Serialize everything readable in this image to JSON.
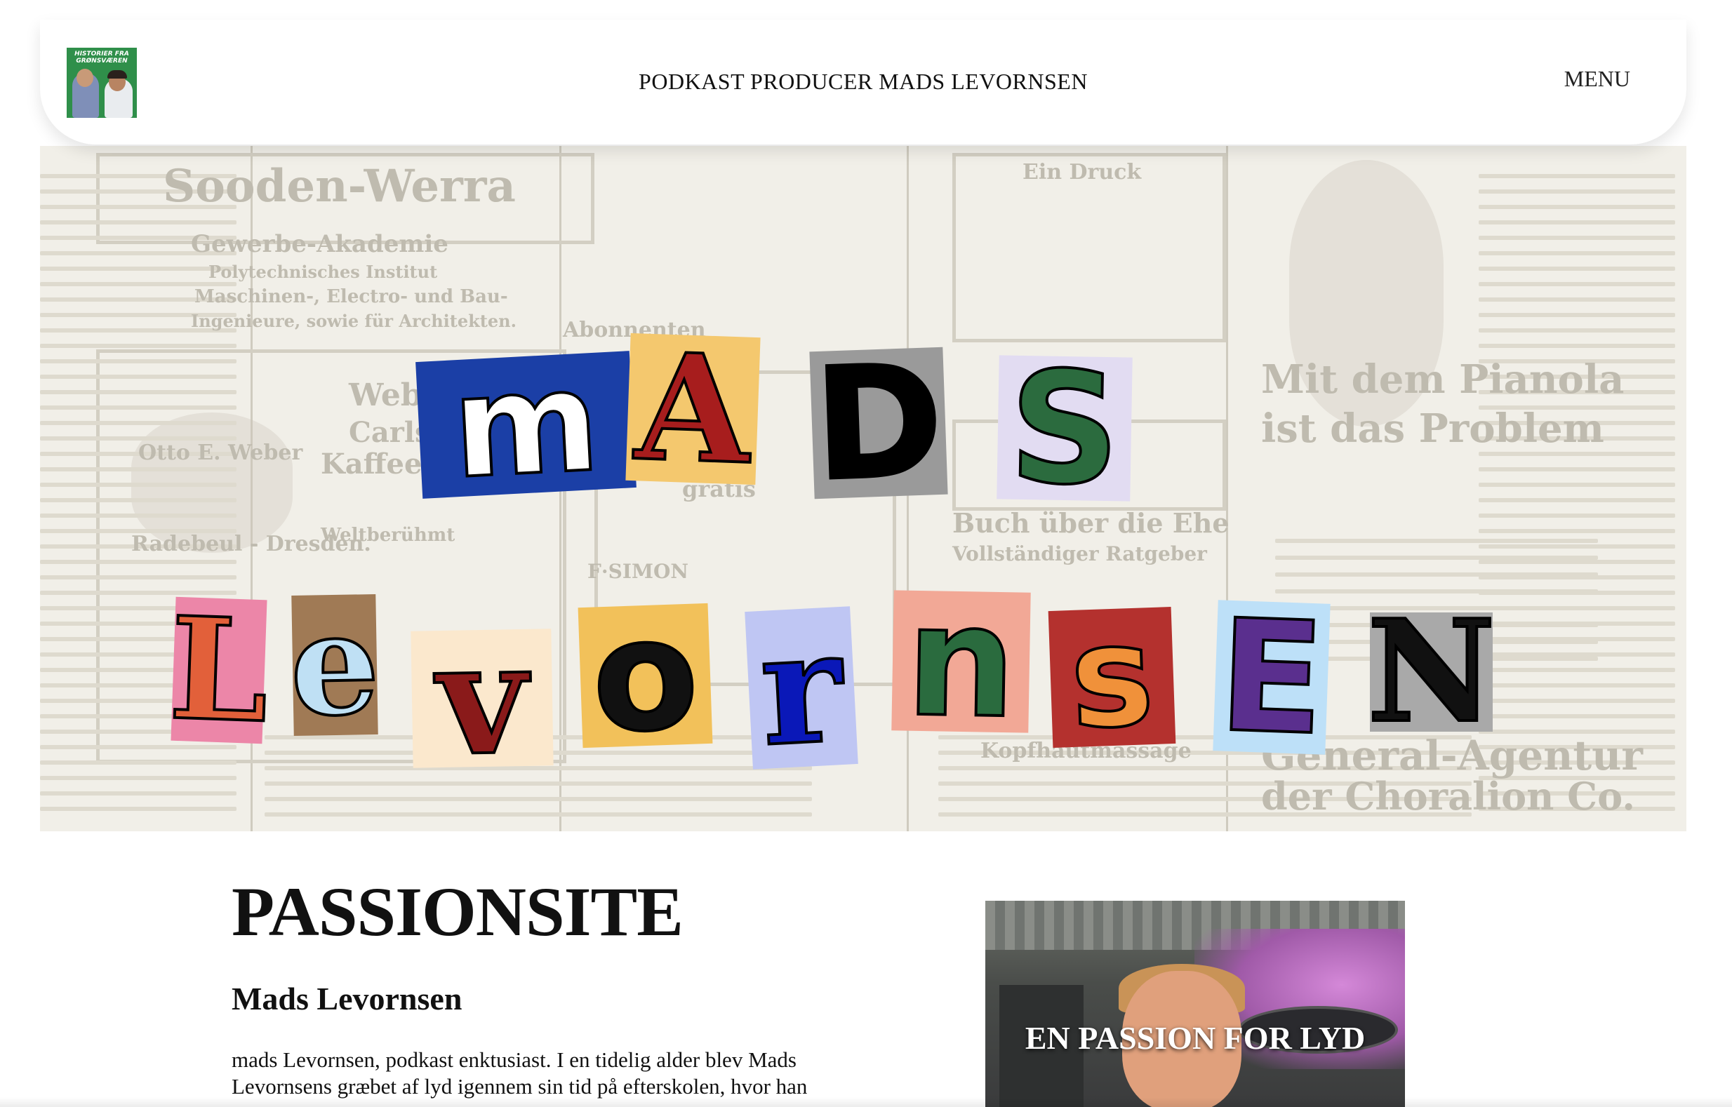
{
  "header": {
    "logo_text": "HISTORIER FRA GRØNSVÆREN",
    "site_title": "PODKAST PRODUCER MADS LEVORNSEN",
    "menu_label": "MENU"
  },
  "hero": {
    "newspaper_words": [
      "Sooden-Werra",
      "Gewerbe-Akademie",
      "Polytechnisches Institut",
      "Maschinen-, Electro- und Bau-",
      "Ingenieure, sowie für Architekten.",
      "Abonnenten",
      "Weber",
      "Carlsb",
      "Kaffeeg",
      "Otto E. Weber",
      "Radebeul - Dresden.",
      "Weltberühmt",
      "F·SIMON",
      "gratis",
      "Ein Druck",
      "Buch über die Ehe",
      "Vollständiger Ratgeber",
      "Mit dem Pianola",
      "ist das Problem",
      "Kopfhautmassage",
      "General-Agentur",
      "der Choralion Co."
    ],
    "ransom_word_1": [
      "m",
      "A",
      "D",
      "S"
    ],
    "ransom_word_2": [
      "L",
      "e",
      "v",
      "o",
      "r",
      "n",
      "s",
      "E",
      "N"
    ]
  },
  "content": {
    "heading": "PASSIONSITE",
    "subheading": "Mads Levornsen",
    "body": "mads Levornsen, podkast enktusiast. I en tidelig alder blev Mads Levornsens græbet af lyd igennem sin tid på efterskolen, hvor han",
    "photo_caption": "EN PASSION FOR LYD"
  }
}
